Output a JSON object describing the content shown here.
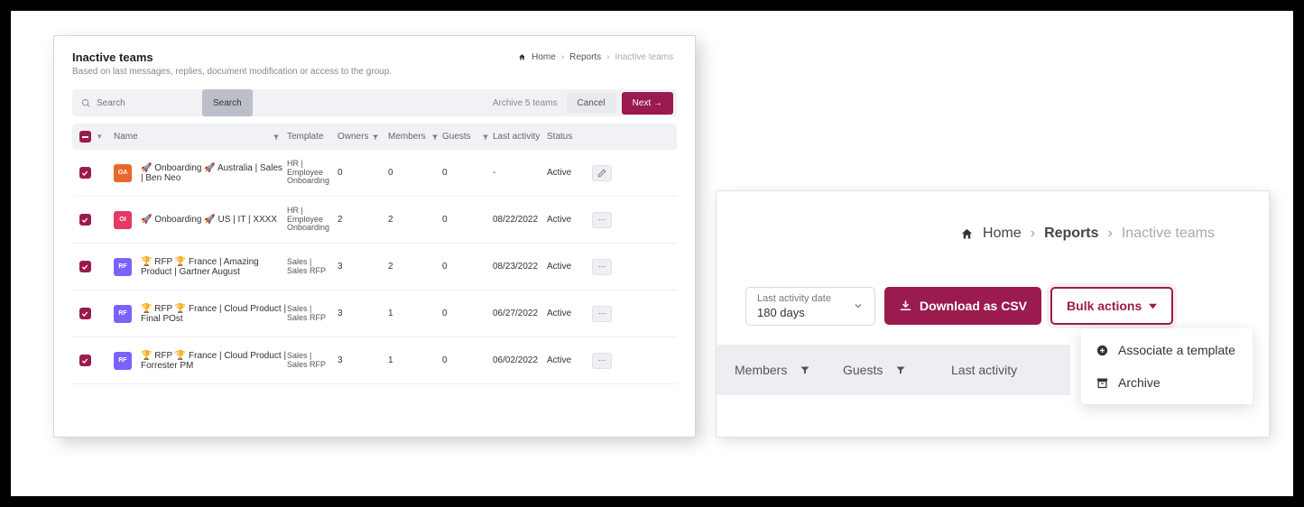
{
  "left": {
    "title": "Inactive teams",
    "subtitle": "Based on last messages, replies, document modification or access to the group.",
    "breadcrumb": {
      "home": "Home",
      "reports": "Reports",
      "current": "Inactive teams"
    },
    "search": {
      "placeholder": "Search",
      "button": "Search"
    },
    "archive_text": "Archive 5 teams",
    "cancel": "Cancel",
    "next": "Next →",
    "columns": {
      "name": "Name",
      "template": "Template",
      "owners": "Owners",
      "members": "Members",
      "guests": "Guests",
      "last_activity": "Last activity",
      "status": "Status"
    },
    "rows": [
      {
        "avatar": "OA",
        "avatar_color": "av-orange",
        "name": "🚀 Onboarding 🚀 Australia | Sales | Ben Neo",
        "template": "HR | Employee Onboarding",
        "owners": "0",
        "members": "0",
        "guests": "0",
        "last": "-",
        "status": "Active",
        "icon": "edit"
      },
      {
        "avatar": "OI",
        "avatar_color": "av-red",
        "name": "🚀 Onboarding 🚀 US | IT | XXXX",
        "template": "HR | Employee Onboarding",
        "owners": "2",
        "members": "2",
        "guests": "0",
        "last": "08/22/2022",
        "status": "Active",
        "icon": "dots"
      },
      {
        "avatar": "RF",
        "avatar_color": "av-purple",
        "name": "🏆 RFP 🏆 France | Amazing Product | Gartner August",
        "template": "Sales | Sales RFP",
        "owners": "3",
        "members": "2",
        "guests": "0",
        "last": "08/23/2022",
        "status": "Active",
        "icon": "dots"
      },
      {
        "avatar": "RF",
        "avatar_color": "av-purple",
        "name": "🏆 RFP 🏆 France | Cloud Product | Final POst",
        "template": "Sales | Sales RFP",
        "owners": "3",
        "members": "1",
        "guests": "0",
        "last": "06/27/2022",
        "status": "Active",
        "icon": "dots"
      },
      {
        "avatar": "RF",
        "avatar_color": "av-purple",
        "name": "🏆 RFP 🏆 France | Cloud Product | Forrester PM",
        "template": "Sales | Sales RFP",
        "owners": "3",
        "members": "1",
        "guests": "0",
        "last": "06/02/2022",
        "status": "Active",
        "icon": "dots"
      }
    ]
  },
  "right": {
    "breadcrumb": {
      "home": "Home",
      "reports": "Reports",
      "current": "Inactive teams"
    },
    "dropdown": {
      "label": "Last activity date",
      "value": "180 days"
    },
    "download": "Download as CSV",
    "bulk": "Bulk actions",
    "menu": {
      "associate": "Associate a template",
      "archive": "Archive"
    },
    "columns": {
      "members": "Members",
      "guests": "Guests",
      "last_activity": "Last activity"
    }
  }
}
